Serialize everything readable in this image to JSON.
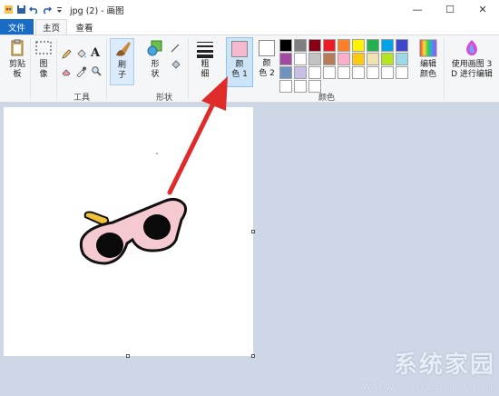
{
  "window": {
    "title": "jpg (2) - 画图",
    "minimize": "—",
    "maximize": "☐",
    "close": "✕"
  },
  "tabs": {
    "file": "文件",
    "home": "主页",
    "view": "查看"
  },
  "ribbon": {
    "clipboard": {
      "label": "剪贴\n板",
      "arrow": "▾"
    },
    "image": {
      "label": "图\n像"
    },
    "tools_group": "工具",
    "brush": {
      "label": "刷\n子"
    },
    "shapes": {
      "label": "形\n状"
    },
    "shapes_group": "形状",
    "size": {
      "label": "粗\n细"
    },
    "color1": {
      "label": "颜\n色 1",
      "value": "#f4b9cf"
    },
    "color2": {
      "label": "颜\n色 2",
      "value": "#ffffff"
    },
    "colors_group": "颜色",
    "edit_colors": {
      "label": "编辑\n颜色"
    },
    "paint3d": {
      "label": "使用画图 3\nD 进行编辑"
    }
  },
  "palette": [
    "#000000",
    "#7f7f7f",
    "#880015",
    "#ed1c24",
    "#ff7f27",
    "#fff200",
    "#22b14c",
    "#00a2e8",
    "#3f48cc",
    "#a349a4",
    "#ffffff",
    "#c3c3c3",
    "#b97a57",
    "#ffaec9",
    "#ffc90e",
    "#efe4b0",
    "#b5e61d",
    "#99d9ea",
    "#7092be",
    "#c8bfe7",
    "#ffffff",
    "#ffffff",
    "#ffffff",
    "#ffffff",
    "#ffffff",
    "#ffffff",
    "#ffffff",
    "#ffffff",
    "#ffffff",
    "#ffffff"
  ],
  "canvas": {
    "background": "#ffffff"
  },
  "watermark": {
    "main": "系统家园",
    "sub": "www.boledir.com"
  },
  "colors": {
    "accent": "#1a6bc4",
    "arrow": "#e02b2b",
    "glasses_frame": "#f4c9cf"
  }
}
